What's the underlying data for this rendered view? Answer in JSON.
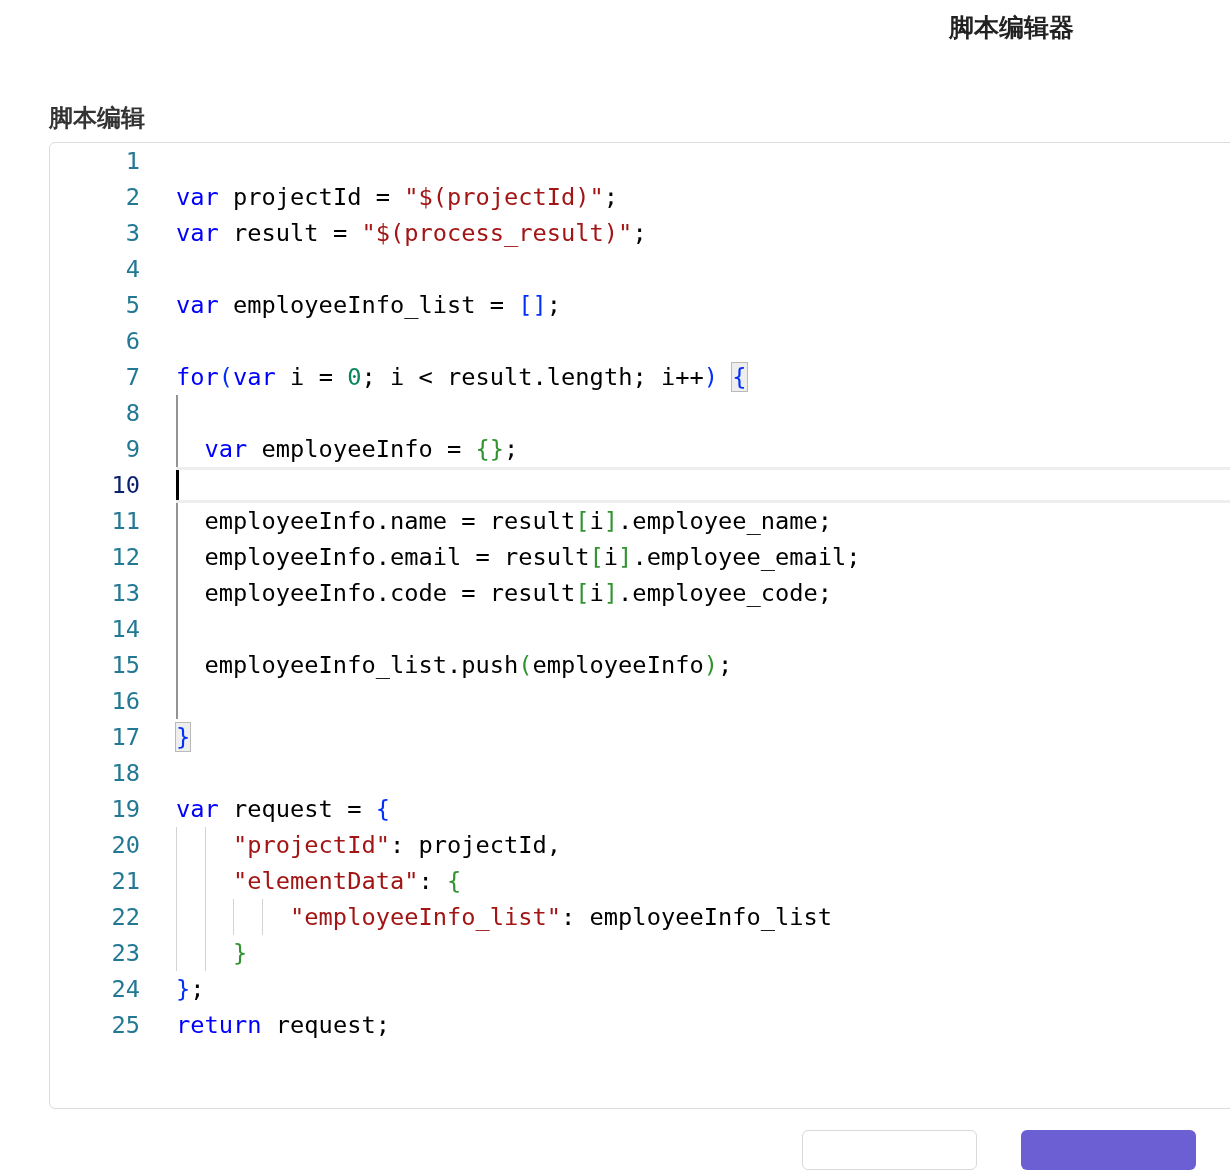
{
  "dialog": {
    "title": "脚本编辑器"
  },
  "editor": {
    "label": "脚本编辑",
    "lines": [
      {
        "number": "1"
      },
      {
        "number": "2",
        "tokens": [
          {
            "text": "var",
            "kind": "keyword"
          },
          {
            "text": " projectId = ",
            "kind": "plain"
          },
          {
            "text": "\"$(projectId)\"",
            "kind": "string"
          },
          {
            "text": ";",
            "kind": "plain"
          }
        ]
      },
      {
        "number": "3",
        "tokens": [
          {
            "text": "var",
            "kind": "keyword"
          },
          {
            "text": " result = ",
            "kind": "plain"
          },
          {
            "text": "\"$(process_result)\"",
            "kind": "string"
          },
          {
            "text": ";",
            "kind": "plain"
          }
        ]
      },
      {
        "number": "4"
      },
      {
        "number": "5",
        "tokens": [
          {
            "text": "var",
            "kind": "keyword"
          },
          {
            "text": " employeeInfo_list = ",
            "kind": "plain"
          },
          {
            "text": "[]",
            "kind": "outer"
          },
          {
            "text": ";",
            "kind": "plain"
          }
        ]
      },
      {
        "number": "6"
      },
      {
        "number": "7",
        "tokens": [
          {
            "text": "for",
            "kind": "keyword"
          },
          {
            "text": "(",
            "kind": "outer"
          },
          {
            "text": "var",
            "kind": "keyword"
          },
          {
            "text": " i = ",
            "kind": "plain"
          },
          {
            "text": "0",
            "kind": "number"
          },
          {
            "text": "; i < result.length; i++",
            "kind": "plain"
          },
          {
            "text": ") ",
            "kind": "outer"
          },
          {
            "text": "{",
            "kind": "matched"
          }
        ]
      },
      {
        "number": "8",
        "scope": true
      },
      {
        "number": "9",
        "scope": true,
        "tokens": [
          {
            "text": "  var",
            "kind": "keyword"
          },
          {
            "text": " employeeInfo = ",
            "kind": "plain"
          },
          {
            "text": "{}",
            "kind": "inner"
          },
          {
            "text": ";",
            "kind": "plain"
          }
        ]
      },
      {
        "number": "10",
        "scope": true,
        "current": true
      },
      {
        "number": "11",
        "scope": true,
        "tokens": [
          {
            "text": "  employeeInfo.name = result",
            "kind": "plain"
          },
          {
            "text": "[",
            "kind": "inner"
          },
          {
            "text": "i",
            "kind": "plain"
          },
          {
            "text": "]",
            "kind": "inner"
          },
          {
            "text": ".employee_name;",
            "kind": "plain"
          }
        ]
      },
      {
        "number": "12",
        "scope": true,
        "tokens": [
          {
            "text": "  employeeInfo.email = result",
            "kind": "plain"
          },
          {
            "text": "[",
            "kind": "inner"
          },
          {
            "text": "i",
            "kind": "plain"
          },
          {
            "text": "]",
            "kind": "inner"
          },
          {
            "text": ".employee_email;",
            "kind": "plain"
          }
        ]
      },
      {
        "number": "13",
        "scope": true,
        "tokens": [
          {
            "text": "  employeeInfo.code = result",
            "kind": "plain"
          },
          {
            "text": "[",
            "kind": "inner"
          },
          {
            "text": "i",
            "kind": "plain"
          },
          {
            "text": "]",
            "kind": "inner"
          },
          {
            "text": ".employee_code;",
            "kind": "plain"
          }
        ]
      },
      {
        "number": "14",
        "scope": true
      },
      {
        "number": "15",
        "scope": true,
        "tokens": [
          {
            "text": "  employeeInfo_list.push",
            "kind": "plain"
          },
          {
            "text": "(",
            "kind": "inner"
          },
          {
            "text": "employeeInfo",
            "kind": "plain"
          },
          {
            "text": ")",
            "kind": "inner"
          },
          {
            "text": ";",
            "kind": "plain"
          }
        ]
      },
      {
        "number": "16",
        "scope": true
      },
      {
        "number": "17",
        "tokens": [
          {
            "text": "}",
            "kind": "matched"
          }
        ]
      },
      {
        "number": "18"
      },
      {
        "number": "19",
        "tokens": [
          {
            "text": "var",
            "kind": "keyword"
          },
          {
            "text": " request = ",
            "kind": "plain"
          },
          {
            "text": "{",
            "kind": "outer"
          }
        ]
      },
      {
        "number": "20",
        "tokens": [
          {
            "text": "    \"projectId\"",
            "kind": "string"
          },
          {
            "text": ": projectId,",
            "kind": "plain"
          }
        ]
      },
      {
        "number": "21",
        "tokens": [
          {
            "text": "    \"elementData\"",
            "kind": "string"
          },
          {
            "text": ": ",
            "kind": "plain"
          },
          {
            "text": "{",
            "kind": "inner"
          }
        ]
      },
      {
        "number": "22",
        "tokens": [
          {
            "text": "        \"employeeInfo_list\"",
            "kind": "string"
          },
          {
            "text": ": employeeInfo_list",
            "kind": "plain"
          }
        ]
      },
      {
        "number": "23",
        "tokens": [
          {
            "text": "    }",
            "kind": "inner"
          }
        ]
      },
      {
        "number": "24",
        "tokens": [
          {
            "text": "}",
            "kind": "outer"
          },
          {
            "text": ";",
            "kind": "plain"
          }
        ]
      },
      {
        "number": "25",
        "tokens": [
          {
            "text": "return",
            "kind": "keyword"
          },
          {
            "text": " request;",
            "kind": "plain"
          }
        ]
      }
    ]
  },
  "footer_buttons": [
    {
      "kind": "secondary"
    },
    {
      "kind": "primary"
    }
  ]
}
